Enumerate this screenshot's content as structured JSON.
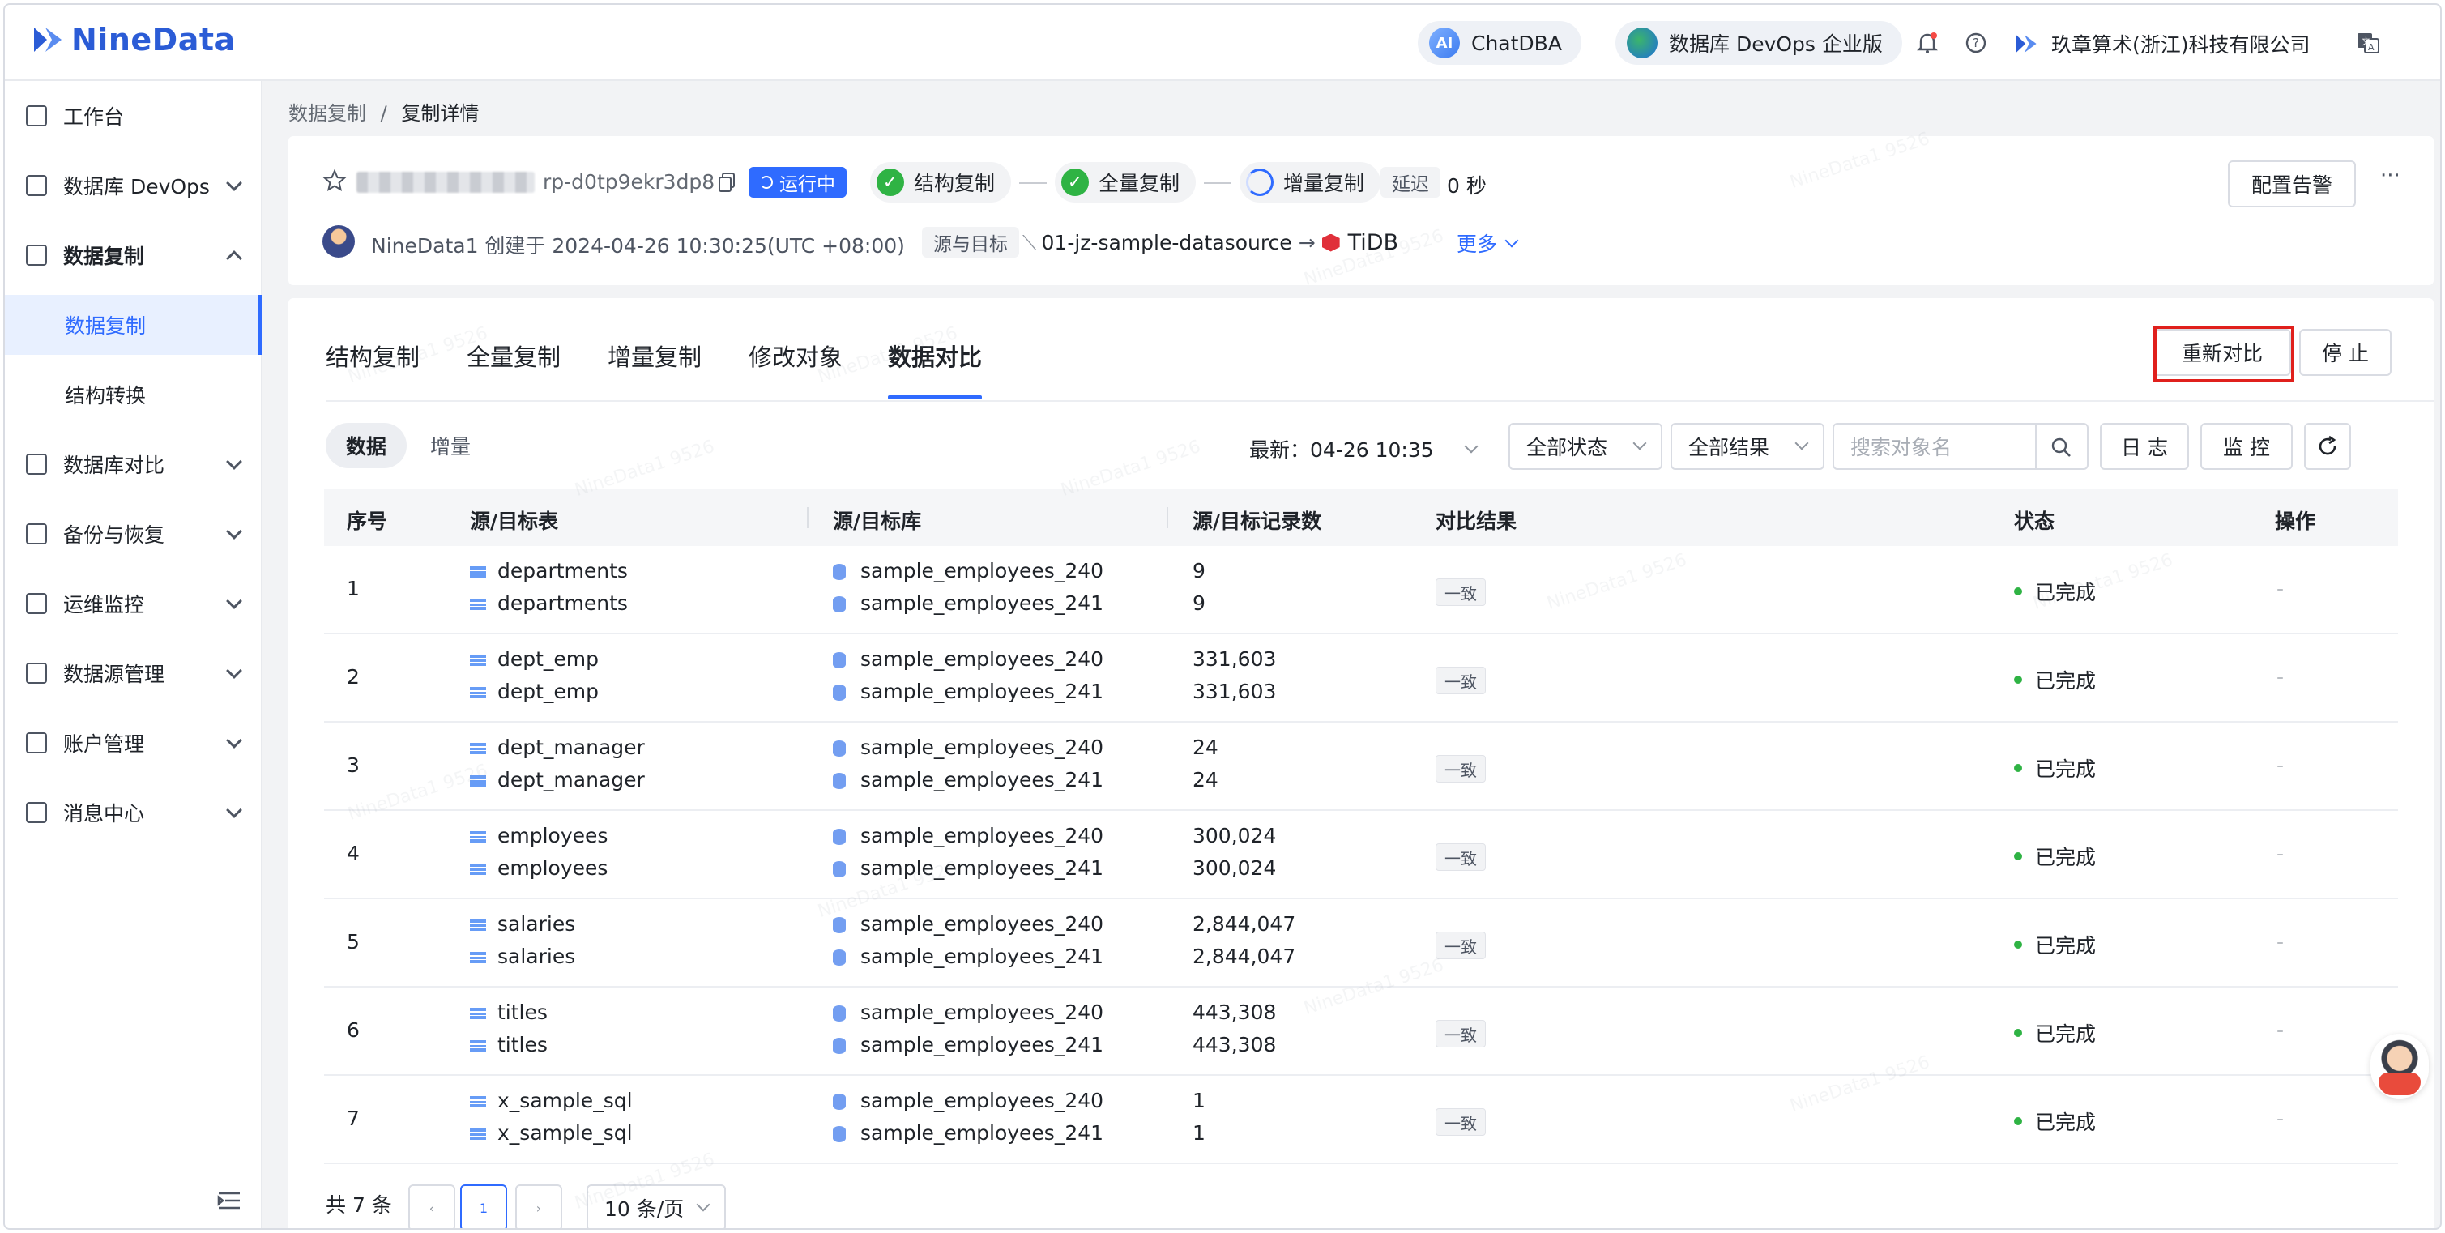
{
  "header": {
    "logo_text": "NineData",
    "chatdba_label": "ChatDBA",
    "chatdba_icon_text": "AI",
    "edition_label": "数据库 DevOps 企业版",
    "company_name": "玖章算术(浙江)科技有限公司"
  },
  "sidebar": {
    "items": [
      {
        "label": "工作台",
        "icon": "home-icon"
      },
      {
        "label": "数据库 DevOps",
        "icon": "devops-icon"
      },
      {
        "label": "数据复制",
        "icon": "replication-icon"
      },
      {
        "label": "数据复制",
        "icon": ""
      },
      {
        "label": "结构转换",
        "icon": ""
      },
      {
        "label": "数据库对比",
        "icon": "compare-icon"
      },
      {
        "label": "备份与恢复",
        "icon": "backup-icon"
      },
      {
        "label": "运维监控",
        "icon": "monitor-icon"
      },
      {
        "label": "数据源管理",
        "icon": "datasource-icon"
      },
      {
        "label": "账户管理",
        "icon": "account-icon"
      },
      {
        "label": "消息中心",
        "icon": "mail-icon"
      }
    ]
  },
  "breadcrumb": {
    "parent": "数据复制",
    "separator": "/",
    "current": "复制详情"
  },
  "task": {
    "id": "rp-d0tp9ekr3dp8",
    "status": "运行中",
    "steps": [
      "结构复制",
      "全量复制",
      "增量复制"
    ],
    "delay_label": "延迟",
    "delay_value": "0 秒",
    "alert_button": "配置告警",
    "more_icon": "···",
    "creator_line": "NineData1 创建于 2024-04-26 10:30:25(UTC +08:00)",
    "source_target_label": "源与目标",
    "source": "01-jz-sample-datasource",
    "target": "TiDB",
    "more_link": "更多"
  },
  "tabs": [
    "结构复制",
    "全量复制",
    "增量复制",
    "修改对象",
    "数据对比"
  ],
  "actions": {
    "recompare": "重新对比",
    "stop": "停 止"
  },
  "filters": {
    "seg_data": "数据",
    "seg_incremental": "增量",
    "latest": "最新：04-26 10:35",
    "status_select": "全部状态",
    "result_select": "全部结果",
    "search_placeholder": "搜索对象名",
    "log_button": "日 志",
    "monitor_button": "监 控"
  },
  "table": {
    "headers": [
      "序号",
      "源/目标表",
      "源/目标库",
      "源/目标记录数",
      "对比结果",
      "状态",
      "操作"
    ],
    "rows": [
      {
        "no": "1",
        "src_table": "departments",
        "dst_table": "departments",
        "src_db": "sample_employees_240",
        "dst_db": "sample_employees_241",
        "src_count": "9",
        "dst_count": "9",
        "result": "一致",
        "status": "已完成",
        "op": "-"
      },
      {
        "no": "2",
        "src_table": "dept_emp",
        "dst_table": "dept_emp",
        "src_db": "sample_employees_240",
        "dst_db": "sample_employees_241",
        "src_count": "331,603",
        "dst_count": "331,603",
        "result": "一致",
        "status": "已完成",
        "op": "-"
      },
      {
        "no": "3",
        "src_table": "dept_manager",
        "dst_table": "dept_manager",
        "src_db": "sample_employees_240",
        "dst_db": "sample_employees_241",
        "src_count": "24",
        "dst_count": "24",
        "result": "一致",
        "status": "已完成",
        "op": "-"
      },
      {
        "no": "4",
        "src_table": "employees",
        "dst_table": "employees",
        "src_db": "sample_employees_240",
        "dst_db": "sample_employees_241",
        "src_count": "300,024",
        "dst_count": "300,024",
        "result": "一致",
        "status": "已完成",
        "op": "-"
      },
      {
        "no": "5",
        "src_table": "salaries",
        "dst_table": "salaries",
        "src_db": "sample_employees_240",
        "dst_db": "sample_employees_241",
        "src_count": "2,844,047",
        "dst_count": "2,844,047",
        "result": "一致",
        "status": "已完成",
        "op": "-"
      },
      {
        "no": "6",
        "src_table": "titles",
        "dst_table": "titles",
        "src_db": "sample_employees_240",
        "dst_db": "sample_employees_241",
        "src_count": "443,308",
        "dst_count": "443,308",
        "result": "一致",
        "status": "已完成",
        "op": "-"
      },
      {
        "no": "7",
        "src_table": "x_sample_sql",
        "dst_table": "x_sample_sql",
        "src_db": "sample_employees_240",
        "dst_db": "sample_employees_241",
        "src_count": "1",
        "dst_count": "1",
        "result": "一致",
        "status": "已完成",
        "op": "-"
      }
    ]
  },
  "pagination": {
    "total": "共 7 条",
    "current_page": "1",
    "page_size": "10 条/页"
  },
  "watermark_text": "NineData1 9526",
  "colors": {
    "brand": "#2b5cd6",
    "accent": "#2f6bff",
    "success": "#2fb344",
    "highlight": "#e0201c"
  }
}
